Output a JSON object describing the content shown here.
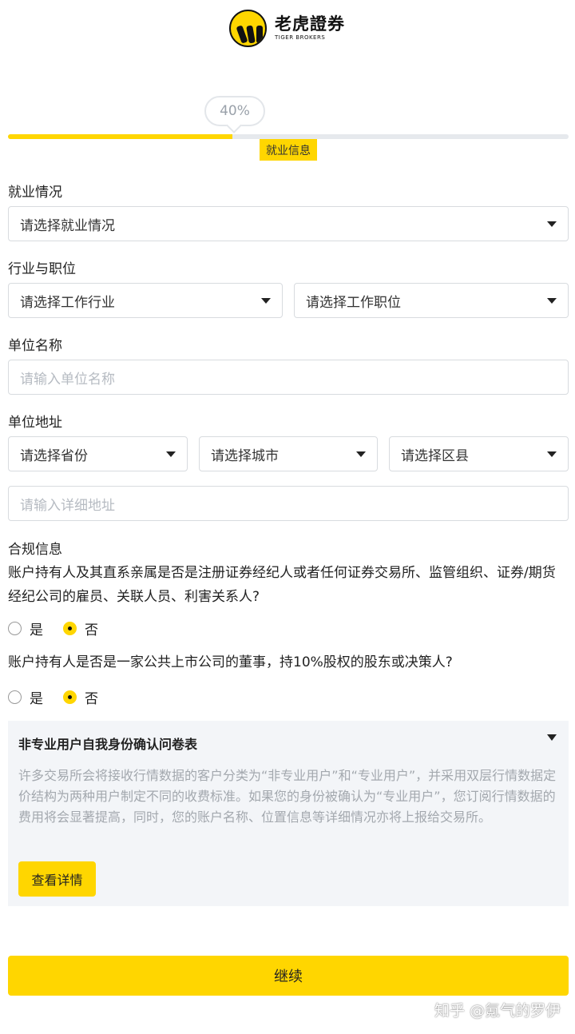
{
  "brand": {
    "name_cn": "老虎證券",
    "name_en": "TIGER BROKERS",
    "accent_color": "#ffd600"
  },
  "progress": {
    "percent_label": "40%",
    "fraction": 0.4,
    "step_label": "就业信息"
  },
  "employment": {
    "label": "就业情况",
    "select_placeholder": "请选择就业情况"
  },
  "industry": {
    "label": "行业与职位",
    "industry_placeholder": "请选择工作行业",
    "position_placeholder": "请选择工作职位"
  },
  "company": {
    "label": "单位名称",
    "placeholder": "请输入单位名称"
  },
  "address": {
    "label": "单位地址",
    "province_placeholder": "请选择省份",
    "city_placeholder": "请选择城市",
    "district_placeholder": "请选择区县",
    "detail_placeholder": "请输入详细地址"
  },
  "compliance": {
    "label": "合规信息",
    "q1": "账户持有人及其直系亲属是否是注册证券经纪人或者任何证券交易所、监管组织、证券/期货经纪公司的雇员、关联人员、利害关系人?",
    "q2": "账户持有人是否是一家公共上市公司的董事，持10%股权的股东或决策人?",
    "yes": "是",
    "no": "否",
    "q1_selected": "否",
    "q2_selected": "否"
  },
  "questionnaire": {
    "title": "非专业用户自我身份确认问卷表",
    "body": "许多交易所会将接收行情数据的客户分类为“非专业用户”和“专业用户”，并采用双层行情数据定价结构为两种用户制定不同的收费标准。如果您的身份被确认为“专业用户”，您订阅行情数据的费用将会显著提高，同时，您的账户名称、位置信息等详细情况亦将上报给交易所。",
    "button": "查看详情"
  },
  "continue_button": "继续",
  "watermark": "知乎 @氪气的罗伊"
}
